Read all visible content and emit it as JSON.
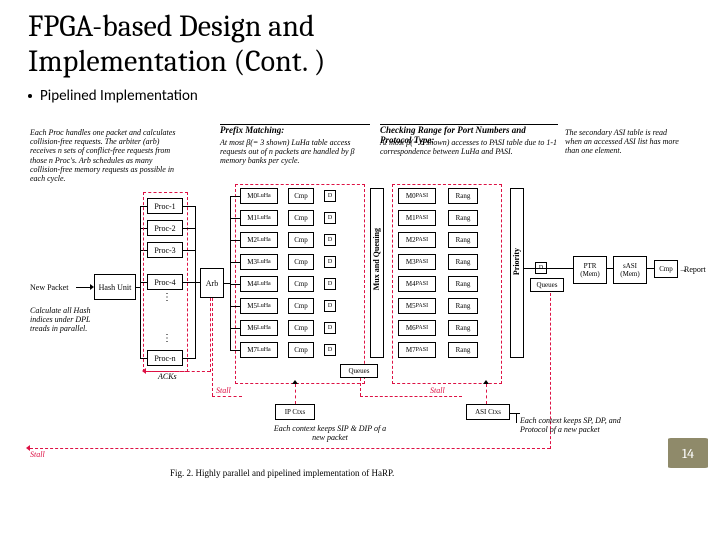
{
  "slide": {
    "title_line1": "FPGA-based Design and",
    "title_line2": "Implementation (Cont. )",
    "bullet": "Pipelined Implementation",
    "page_number": "14"
  },
  "diagram": {
    "headers": {
      "prefix_matching": "Prefix Matching:",
      "prefix_note": "At most β(= 3 shown) LuHa table access requests out of n packets are handled by β memory banks per cycle.",
      "checking_range": "Checking Range for Port Numbers and Protocol Type:",
      "checking_note": "At most β(= 8 shown) accesses to PASI table due to 1-1 correspondence between LuHa and PASI."
    },
    "notes": {
      "proc_note": "Each Proc handles one packet and calculates collision-free requests. The arbiter (arb) receives n sets of conflict-free requests from those n Proc's. Arb schedules as many collision-free memory requests as possible in each cycle.",
      "hash_note": "Calculate all Hash indices under DPL treads in parallel.",
      "asi_note": "The secondary ASI table is read when an accessed ASI list has more than one element.",
      "ip_caption": "Each context keeps SIP & DIP of a new packet",
      "asi_caption": "Each context keeps SP, DP, and Protocol of a new packet"
    },
    "labels": {
      "new_packet": "New Packet",
      "hash_unit": "Hash Unit",
      "arb": "Arb",
      "procs": [
        "Proc-1",
        "Proc-2",
        "Proc-3",
        "Proc-4",
        "Proc-n"
      ],
      "acks": "ACKs",
      "stall": "Stall",
      "ip_ctxs": "IP Ctxs",
      "asi_ctxs": "ASI Ctxs",
      "mux_queue": "Mux and Queuing",
      "queues": "Queues",
      "d": "D",
      "cmp": "Cmp",
      "rang": "Rang",
      "priority": "Priority",
      "ptr_mem": "PTR (Mem)",
      "sasi_mem": "sASI (Mem)",
      "report": "Report"
    },
    "luha": [
      "M0",
      "M1",
      "M2",
      "M3",
      "M4",
      "M5",
      "M6",
      "M7"
    ],
    "pasi": [
      "M0",
      "M1",
      "M2",
      "M3",
      "M4",
      "M5",
      "M6",
      "M7"
    ],
    "caption": "Fig. 2.   Highly parallel and pipelined implementation of HaRP."
  }
}
